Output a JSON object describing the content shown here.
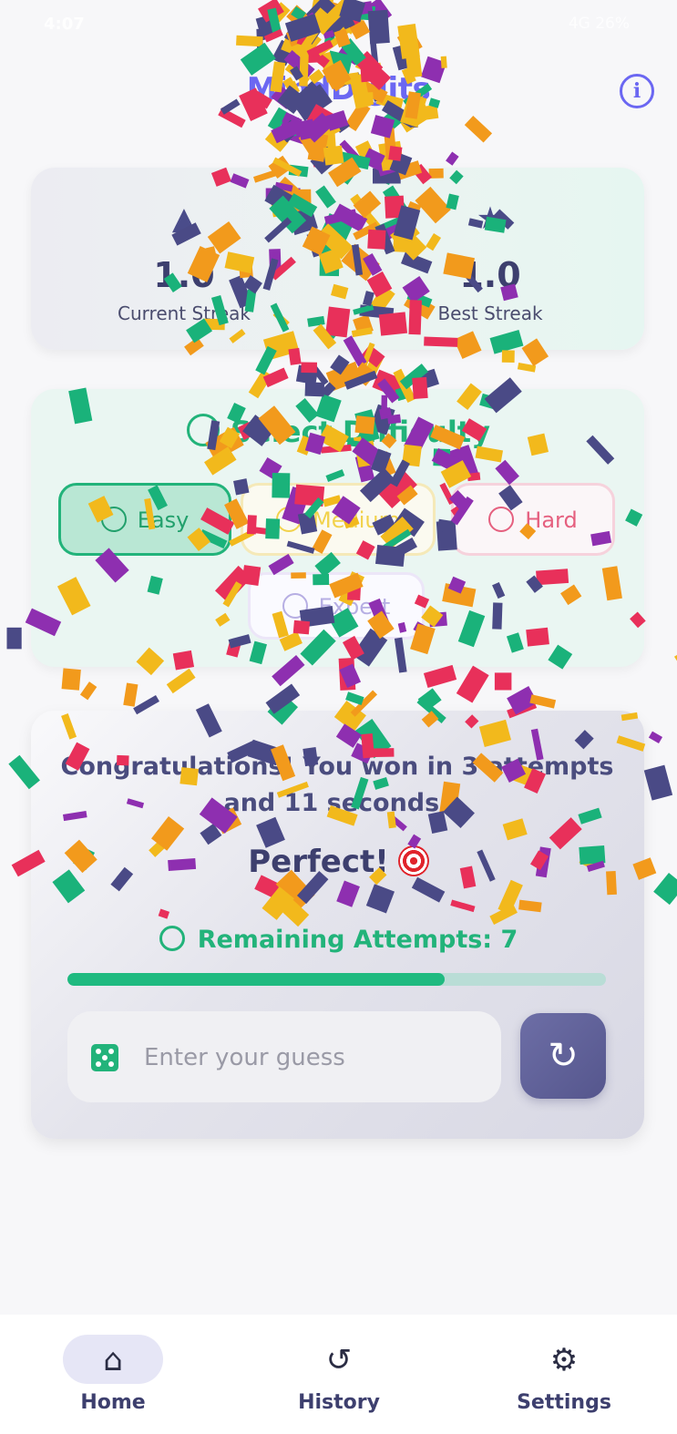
{
  "status_bar": {
    "time": "4:07",
    "right": "4G 26%"
  },
  "app": {
    "title": "MindDigits"
  },
  "streak": {
    "current": {
      "value": "1.0",
      "label": "Current Streak"
    },
    "best": {
      "value": "1.0",
      "label": "Best Streak"
    }
  },
  "difficulty": {
    "title": "Select Difficulty",
    "options": [
      "Easy",
      "Medium",
      "Hard",
      "Expert"
    ],
    "selected": "Easy"
  },
  "game": {
    "message": "Congratulations! You won in 3 attempts and 11 seconds!",
    "rating": "Perfect!",
    "remaining_label": "Remaining Attempts: 7",
    "progress_fraction": 0.7,
    "guess_placeholder": "Enter your guess"
  },
  "nav": {
    "items": [
      {
        "label": "Home",
        "icon": "home-icon",
        "active": true
      },
      {
        "label": "History",
        "icon": "history-icon",
        "active": false
      },
      {
        "label": "Settings",
        "icon": "gear-icon",
        "active": false
      }
    ]
  },
  "colors": {
    "accent": "#22b37a",
    "brand": "#6b67f2",
    "primary": "#55568d"
  }
}
